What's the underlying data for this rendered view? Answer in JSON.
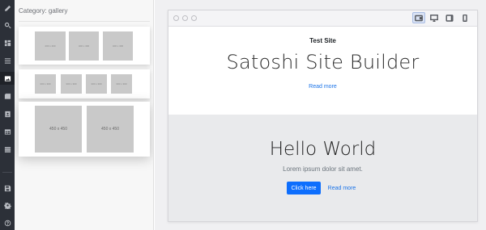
{
  "sidebar": {
    "icons": [
      "pencil-icon",
      "search-icon",
      "dashboard-icon",
      "list-icon",
      "image-icon",
      "gallery-icon",
      "contacts-icon",
      "table-icon",
      "layout-icon",
      "save-icon",
      "settings-icon",
      "help-icon"
    ],
    "active": "image-icon"
  },
  "panel": {
    "category_label": "Category: gallery",
    "blocks": [
      {
        "name": "gallery-4x-small",
        "placeholders": [
          "400 x 400",
          "400 x 400",
          "400 x 400"
        ]
      },
      {
        "name": "gallery-4x-tiny",
        "placeholders": [
          "300 x 300",
          "300 x 300",
          "300 x 300",
          "300 x 300"
        ]
      },
      {
        "name": "gallery-2x-large",
        "placeholders": [
          "450 x 450",
          "450 x 450"
        ]
      }
    ]
  },
  "preview": {
    "devices": [
      "tablet-landscape-icon",
      "desktop-icon",
      "tablet-icon",
      "phone-icon"
    ],
    "active_device": "tablet-landscape-icon",
    "site_title": "Test Site",
    "site_heading": "Satoshi Site Builder",
    "site_link": "Read more",
    "band_heading": "Hello World",
    "band_text": "Lorem ipsum dolor sit amet.",
    "band_button": "Click here",
    "band_link": "Read more"
  },
  "colors": {
    "rail": "#2c3038",
    "accent": "#0d6efd",
    "link": "#1a73e8",
    "band": "#e9eaec"
  }
}
